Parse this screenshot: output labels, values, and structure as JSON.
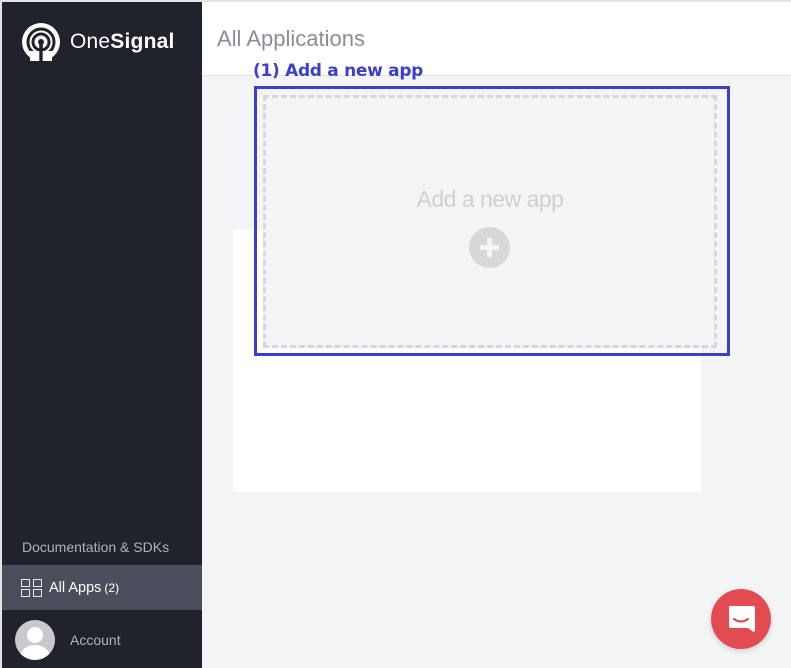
{
  "brand": {
    "name_regular": "One",
    "name_bold": "Signal",
    "logo_icon": "onesignal-logo-icon"
  },
  "sidebar": {
    "docs_link": "Documentation & SDKs",
    "nav": {
      "apps_label": "All Apps",
      "apps_count": "(2)",
      "apps_icon": "grid-icon"
    },
    "account": {
      "label": "Account",
      "avatar_icon": "user-avatar-icon"
    }
  },
  "header": {
    "title": "All Applications"
  },
  "main": {
    "new_app_card": {
      "label": "Add a new app",
      "icon": "plus-circle-icon"
    },
    "annotation": {
      "text": "(1) Add a new app",
      "color": "#3d3fc8"
    }
  },
  "chat_widget": {
    "icon": "chat-icon",
    "color": "#e24b4f"
  },
  "colors": {
    "sidebar_bg": "#20232b",
    "sidebar_active_bg": "#4b4f5b",
    "main_bg": "#f3f4f6"
  }
}
